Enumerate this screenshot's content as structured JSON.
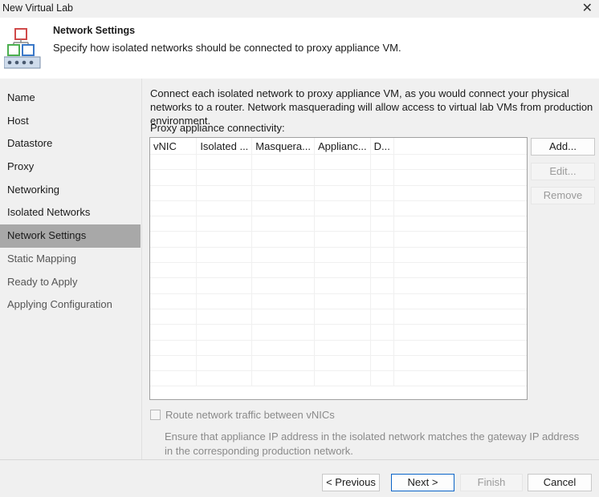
{
  "window": {
    "title": "New Virtual Lab",
    "close_glyph": "✕"
  },
  "header": {
    "title": "Network Settings",
    "description": "Specify how isolated networks should be connected to proxy appliance VM.",
    "icon": "network-settings-icon"
  },
  "sidebar": {
    "items": [
      {
        "label": "Name",
        "state": "enabled"
      },
      {
        "label": "Host",
        "state": "enabled"
      },
      {
        "label": "Datastore",
        "state": "enabled"
      },
      {
        "label": "Proxy",
        "state": "enabled"
      },
      {
        "label": "Networking",
        "state": "enabled"
      },
      {
        "label": "Isolated Networks",
        "state": "enabled"
      },
      {
        "label": "Network Settings",
        "state": "active"
      },
      {
        "label": "Static Mapping",
        "state": "disabled"
      },
      {
        "label": "Ready to Apply",
        "state": "disabled"
      },
      {
        "label": "Applying Configuration",
        "state": "disabled"
      }
    ]
  },
  "main": {
    "intro": "Connect each isolated network to proxy appliance VM, as you would connect your physical networks to a router. Network masquerading will allow access to virtual lab VMs from production environment.",
    "connectivity_label": "Proxy appliance connectivity:",
    "table": {
      "columns": [
        "vNIC",
        "Isolated ...",
        "Masquera...",
        "Applianc...",
        "D..."
      ],
      "rows": []
    },
    "buttons": {
      "add": "Add...",
      "edit": "Edit...",
      "remove": "Remove"
    },
    "route_checkbox": {
      "label": "Route network traffic between vNICs",
      "checked": false,
      "enabled": false
    },
    "note": "Ensure that appliance IP address in the isolated network matches the gateway IP address in the corresponding production network."
  },
  "footer": {
    "previous": "< Previous",
    "next": "Next >",
    "finish": "Finish",
    "cancel": "Cancel"
  },
  "colors": {
    "active_sidebar": "#a8a8a8",
    "primary_border": "#0a64c8",
    "panel_bg": "#f0f0f0"
  }
}
